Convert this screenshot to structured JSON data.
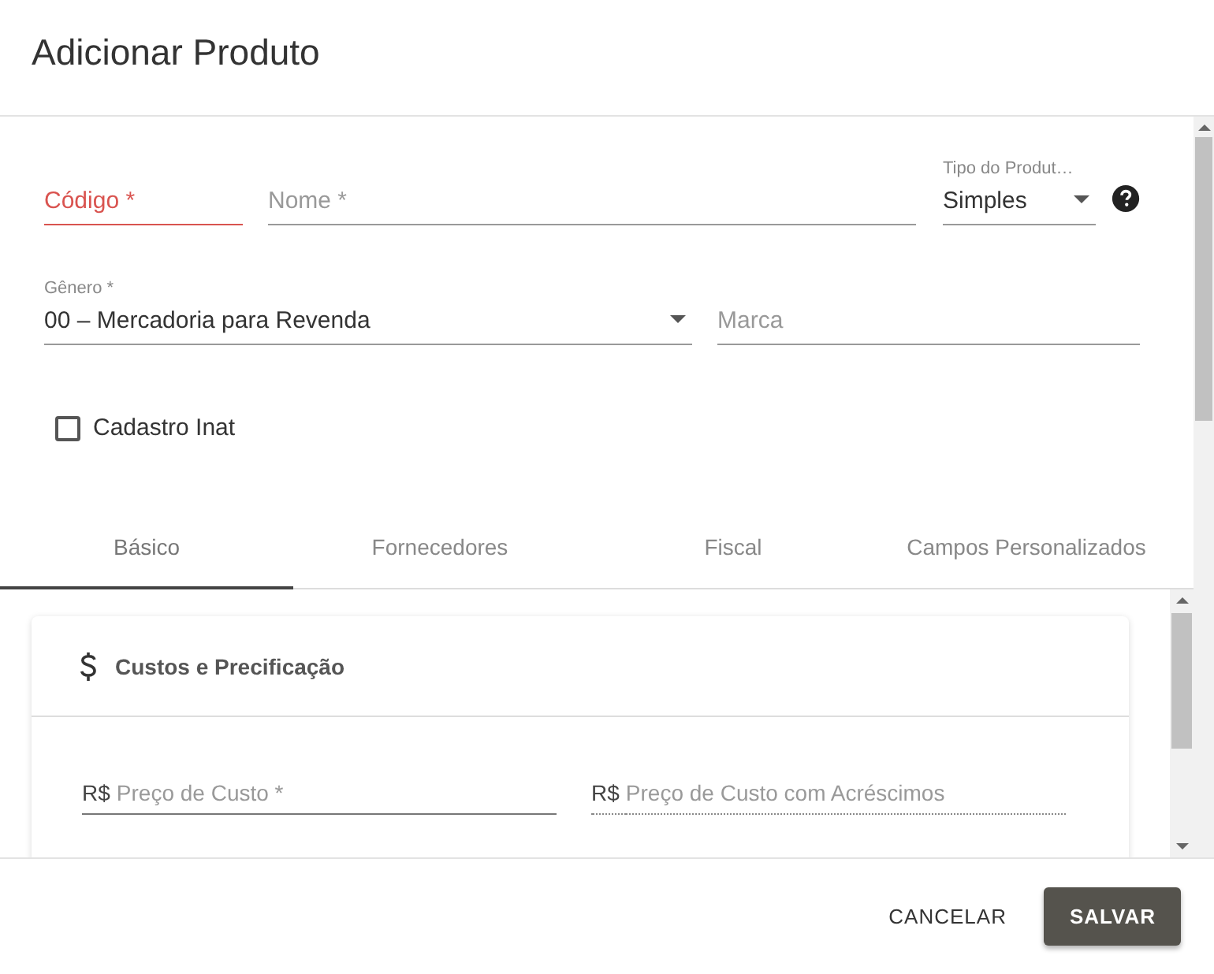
{
  "window": {
    "title": "Adicionar Produto"
  },
  "codigo": {
    "placeholder": "Código *",
    "focused": true
  },
  "nome": {
    "placeholder": "Nome *"
  },
  "tipo": {
    "label": "Tipo do Produt…",
    "value": "Simples"
  },
  "genero": {
    "label": "Gênero *",
    "value": "00 – Mercadoria para Revenda"
  },
  "marca": {
    "placeholder": "Marca"
  },
  "cadastro_inativo": {
    "label": "Cadastro Inat",
    "checked": false
  },
  "tabs": [
    {
      "label": "Básico",
      "selected": true
    },
    {
      "label": "Fornecedores",
      "selected": false
    },
    {
      "label": "Fiscal",
      "selected": false
    },
    {
      "label": "Campos Personalizados",
      "selected": false
    }
  ],
  "section": {
    "title": "Custos e Precificação",
    "fields": [
      {
        "prefix": "R$",
        "placeholder": "Preço de Custo *",
        "disabled": false
      },
      {
        "prefix": "R$",
        "placeholder": "Preço de Custo com Acréscimos",
        "disabled": true
      }
    ]
  },
  "buttons": [
    {
      "label": "CANCELAR",
      "kind": "flat"
    },
    {
      "label": "SALVAR",
      "kind": "raised"
    }
  ]
}
